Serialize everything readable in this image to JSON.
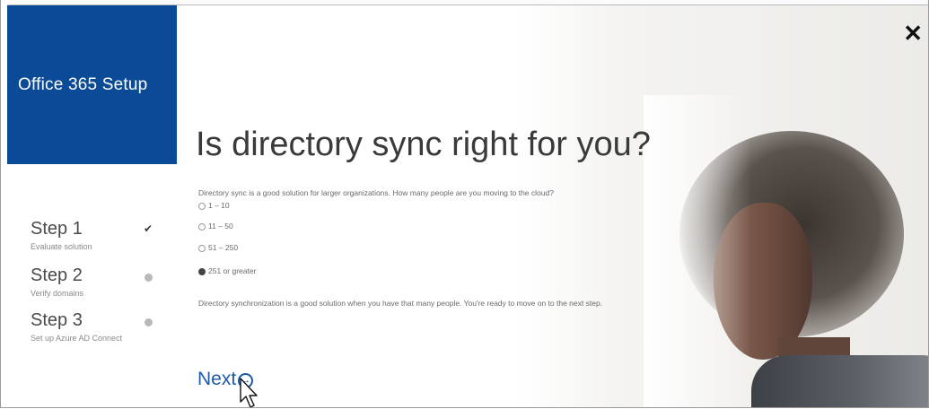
{
  "window": {
    "close_label": "✕"
  },
  "sidebar": {
    "brand_title": "Office 365 Setup",
    "steps": [
      {
        "title": "Step 1",
        "subtitle": "Evaluate solution",
        "status": "complete"
      },
      {
        "title": "Step 2",
        "subtitle": "Verify domains",
        "status": "pending"
      },
      {
        "title": "Step 3",
        "subtitle": "Set up Azure AD Connect",
        "status": "pending"
      }
    ]
  },
  "main": {
    "headline": "Is directory sync right for you?",
    "question": "Directory sync is a good solution for larger organizations. How many people are you moving to the cloud?",
    "options": [
      {
        "label": "1 – 10",
        "selected": false
      },
      {
        "label": "11 – 50",
        "selected": false
      },
      {
        "label": "51 – 250",
        "selected": false
      },
      {
        "label": "251 or greater",
        "selected": true
      }
    ],
    "result": "Directory synchronization is a good solution when you have that many people. You're ready to move on to the next step.",
    "next_label": "Next",
    "next_icon": "arrow-circle-right-icon"
  },
  "colors": {
    "brand": "#0b4a96",
    "link": "#1e5aa6"
  }
}
